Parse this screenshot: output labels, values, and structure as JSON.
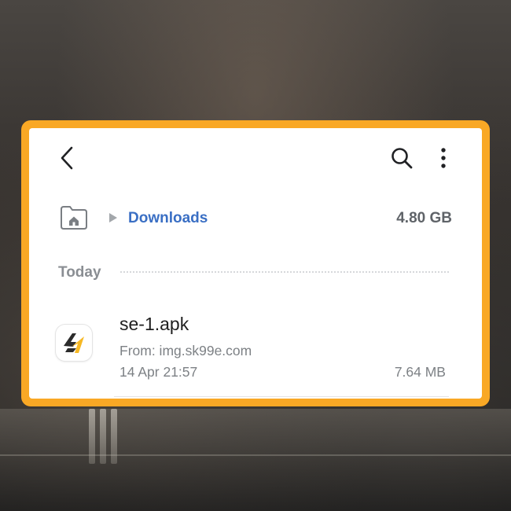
{
  "header": {
    "back_icon": "chevron-left-icon",
    "search_icon": "search-icon",
    "more_icon": "more-vertical-icon"
  },
  "breadcrumb": {
    "home_icon": "home-folder-icon",
    "separator_icon": "triangle-right-icon",
    "current": "Downloads",
    "storage": "4.80 GB"
  },
  "section": {
    "label": "Today"
  },
  "files": [
    {
      "name": "se-1.apk",
      "source": "From: img.sk99e.com",
      "date": "14 Apr 21:57",
      "size": "7.64 MB",
      "icon": "app-logo-icon"
    }
  ],
  "colors": {
    "frame": "#f9a825",
    "accent": "#3a6fc4",
    "logo_dark": "#2b2b2b",
    "logo_yellow": "#f6b824"
  }
}
